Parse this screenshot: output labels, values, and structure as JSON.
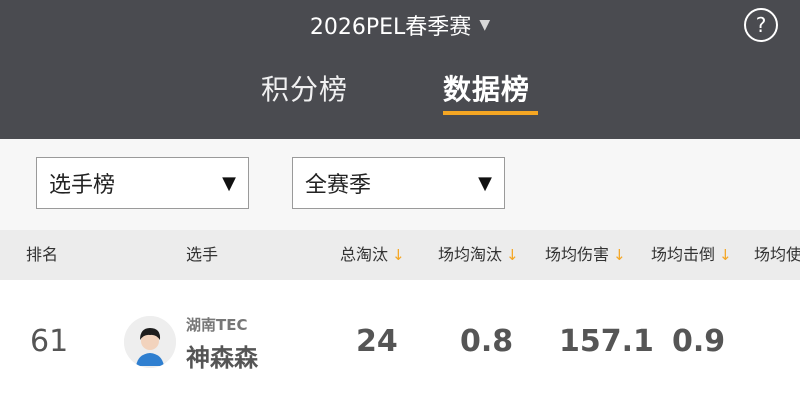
{
  "header": {
    "season": "2026PEL春季赛",
    "season_caret": "▼",
    "help": "?"
  },
  "tabs": [
    {
      "label": "积分榜",
      "active": false
    },
    {
      "label": "数据榜",
      "active": true
    }
  ],
  "filters": {
    "board": "选手榜",
    "season": "全赛季",
    "arrow": "▼"
  },
  "table": {
    "columns": [
      "排名",
      "选手",
      "总淘汰",
      "场均淘汰",
      "场均伤害",
      "场均击倒",
      "场均使"
    ],
    "sort_icon": "↓",
    "rows": [
      {
        "rank": "61",
        "team": "湖南TEC",
        "player": "神森森",
        "total_kills": "24",
        "avg_kills": "0.8",
        "avg_damage": "157.1",
        "avg_knocks": "0.9"
      }
    ]
  },
  "colors": {
    "header_bg": "#4a4b50",
    "accent": "#f5a623"
  }
}
